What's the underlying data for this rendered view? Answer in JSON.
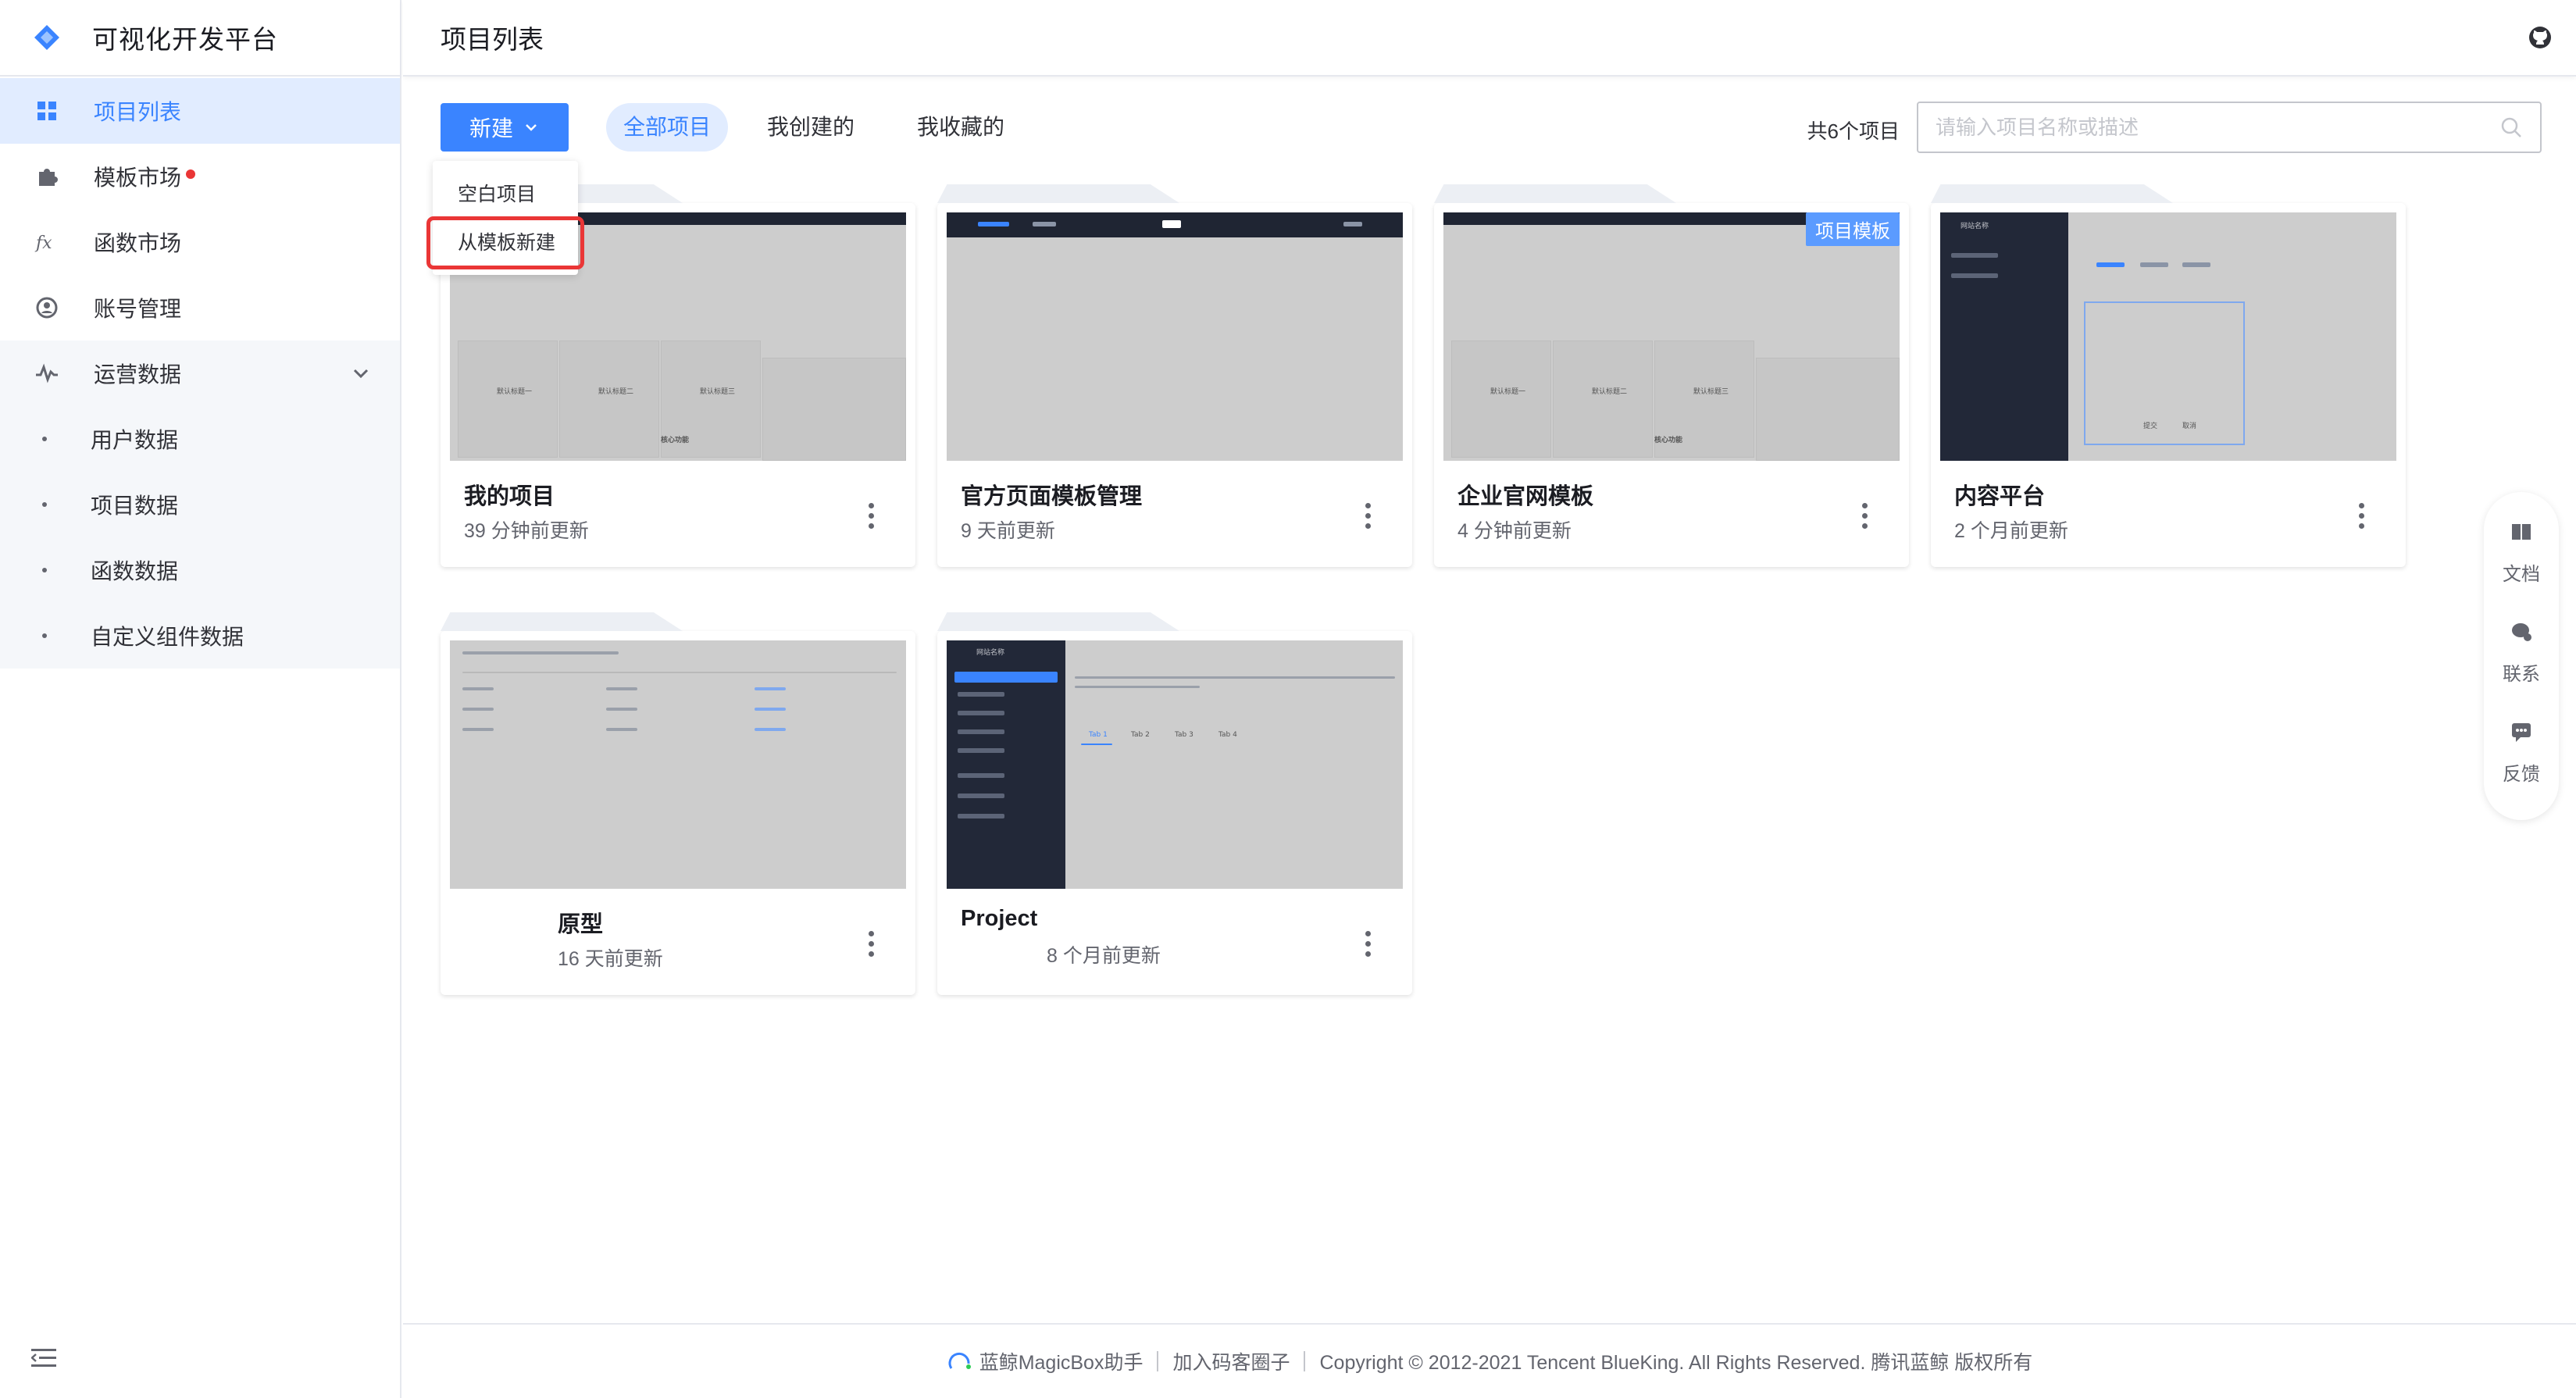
{
  "brand": {
    "title": "可视化开发平台"
  },
  "sidebar": {
    "items": [
      {
        "label": "项目列表",
        "icon": "grid-icon"
      },
      {
        "label": "模板市场",
        "icon": "puzzle-icon"
      },
      {
        "label": "函数市场",
        "icon": "fx-icon"
      },
      {
        "label": "账号管理",
        "icon": "user-circle-icon"
      },
      {
        "label": "运营数据",
        "icon": "chart-icon"
      }
    ],
    "subitems": [
      "用户数据",
      "项目数据",
      "函数数据",
      "自定义组件数据"
    ]
  },
  "header": {
    "title": "项目列表"
  },
  "toolbar": {
    "new_label": "新建",
    "tabs": [
      "全部项目",
      "我创建的",
      "我收藏的"
    ],
    "count": "共6个项目",
    "search_placeholder": "请输入项目名称或描述"
  },
  "dropdown": {
    "items": [
      "空白项目",
      "从模板新建"
    ]
  },
  "cards": [
    {
      "name": "我的项目",
      "meta": "39 分钟前更新"
    },
    {
      "name": "官方页面模板管理",
      "meta": "9 天前更新"
    },
    {
      "name": "企业官网模板",
      "meta": "4 分钟前更新",
      "badge": "项目模板"
    },
    {
      "name": "内容平台",
      "meta": "2 个月前更新"
    },
    {
      "name": "原型",
      "meta": "16 天前更新"
    },
    {
      "name": "Project",
      "meta": "8 个月前更新"
    }
  ],
  "thumbs": {
    "core": "核心功能",
    "cols": [
      "默认标题一",
      "默认标题二",
      "默认标题三"
    ],
    "site": "网站名称",
    "tabs": [
      "Tab 1",
      "Tab 2",
      "Tab 3",
      "Tab 4"
    ],
    "submit": "提交",
    "cancel": "取消"
  },
  "float": [
    "文档",
    "联系",
    "反馈"
  ],
  "footer": {
    "assistant": "蓝鲸MagicBox助手",
    "circle": "加入码客圈子",
    "copyright": "Copyright © 2012-2021 Tencent BlueKing. All Rights Reserved. 腾讯蓝鲸 版权所有"
  },
  "colors": {
    "primary": "#3a84ff",
    "active_bg": "#e1ecff",
    "alert": "#ea3636"
  }
}
